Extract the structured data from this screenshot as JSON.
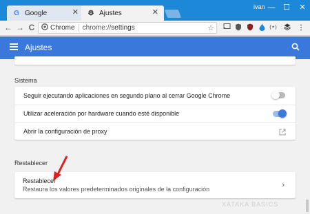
{
  "window": {
    "user": "ivan",
    "minimize_glyph": "—",
    "maximize_glyph": "☐",
    "close_glyph": "✕"
  },
  "tabs": [
    {
      "label": "Google",
      "icon": "google-favicon",
      "glyph": "G",
      "close": "✕"
    },
    {
      "label": "Ajustes",
      "icon": "gear-icon",
      "glyph": "⚙",
      "close": "✕",
      "active": true
    }
  ],
  "toolbar": {
    "back": "←",
    "forward": "→",
    "reload": "C",
    "site_label": "Chrome",
    "url_scheme": "chrome://",
    "url_path": "settings",
    "bookmark_glyph": "☆"
  },
  "header": {
    "title": "Ajustes"
  },
  "sections": {
    "sistema": {
      "title": "Sistema",
      "rows": [
        {
          "label": "Seguir ejecutando aplicaciones en segundo plano al cerrar Google Chrome",
          "toggle": false
        },
        {
          "label": "Utilizar aceleración por hardware cuando esté disponible",
          "toggle": true
        },
        {
          "label": "Abrir la configuración de proxy"
        }
      ]
    },
    "restablecer": {
      "title": "Restablecer",
      "item_title": "Restablecer",
      "item_subtitle": "Restaura los valores predeterminados originales de la configuración",
      "chevron": "›"
    }
  },
  "watermark": "XATAKA BASICS",
  "colors": {
    "titlebar": "#1e88d8",
    "appbar": "#3a78dc",
    "toggle_on": "#3a78dc",
    "arrow": "#e02020"
  }
}
